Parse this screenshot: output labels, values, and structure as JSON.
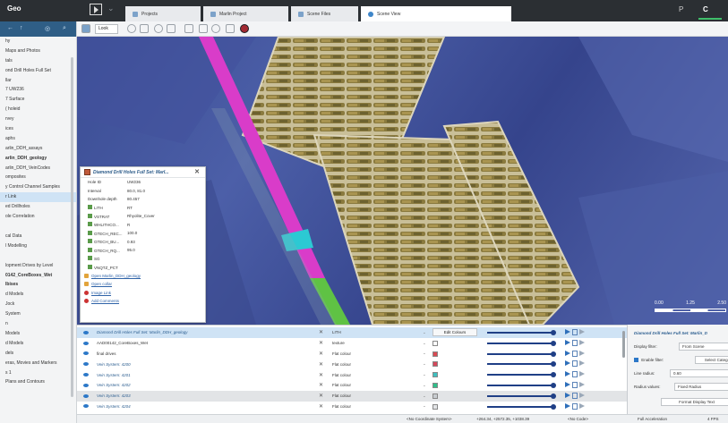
{
  "topbar": {
    "app_name": "Geo",
    "tabs": [
      {
        "label": "Projects"
      },
      {
        "label": "Marlin Project"
      },
      {
        "label": "Scene Files"
      },
      {
        "label": "Scene View"
      }
    ],
    "right_icons": [
      "P",
      "C"
    ]
  },
  "sidebar": {
    "items": [
      {
        "label": "hy"
      },
      {
        "label": "Maps and Photos"
      },
      {
        "label": "tals"
      },
      {
        "label": "ond Drill Holes Full Set"
      },
      {
        "label": "llar"
      },
      {
        "label": "7 UW236"
      },
      {
        "label": "7 Surface"
      },
      {
        "label": "( holeid"
      },
      {
        "label": "rvey"
      },
      {
        "label": "ices"
      },
      {
        "label": "aphs"
      },
      {
        "label": "arlin_DDH_assays"
      },
      {
        "label": "arlin_DDH_geology"
      },
      {
        "label": "arlin_DDH_VeinCodes"
      },
      {
        "label": "omposites"
      },
      {
        "label": "y Control Channel Samples"
      },
      {
        "label": "r Link"
      },
      {
        "label": "ed Drillholes"
      },
      {
        "label": "ole Correlation"
      },
      {
        "label": "cal Data"
      },
      {
        "label": "l Modelling"
      },
      {
        "label": "lopment Drives by Level"
      },
      {
        "label": "0142_CoreBoxes_Wet"
      },
      {
        "label": "Ibises"
      },
      {
        "label": "d Models"
      },
      {
        "label": "Jock"
      },
      {
        "label": "System"
      },
      {
        "label": "n"
      },
      {
        "label": "Models"
      },
      {
        "label": "d Models"
      },
      {
        "label": "dels"
      },
      {
        "label": "eras, Movies and Markers"
      },
      {
        "label": "s 1"
      },
      {
        "label": "Plans and Contours"
      }
    ]
  },
  "scene_toolbar": {
    "look_label": "Look"
  },
  "scale_bar": {
    "ticks": [
      "0.00",
      "1.25",
      "2.50"
    ]
  },
  "popup": {
    "title": "Diamond Drill Holes Full Set: Marl...",
    "rows": [
      {
        "key": "Hole ID",
        "value": "UW236"
      },
      {
        "key": "Interval",
        "value": "80.0, 81.0"
      },
      {
        "key": "Downhole depth",
        "value": "80.457"
      },
      {
        "key": "LITH",
        "value": "RT"
      },
      {
        "key": "VSTRAT",
        "value": "Rhyolite_Cover"
      },
      {
        "key": "WHLITHCO...",
        "value": "R"
      },
      {
        "key": "GTECH_REC...",
        "value": "100.0"
      },
      {
        "key": "GTECH_BU...",
        "value": "0.93"
      },
      {
        "key": "GTECH_RQ...",
        "value": "95.0"
      },
      {
        "key": "SG",
        "value": ""
      },
      {
        "key": "VNQTZ_PCT",
        "value": ""
      }
    ],
    "links": [
      {
        "label": "Open Marlin_DDH_geology"
      },
      {
        "label": "Open collar"
      },
      {
        "label": "Image Link"
      },
      {
        "label": "Add Comments"
      }
    ]
  },
  "layers": [
    {
      "name": "Diamond Drill Holes Full Set: Marlin_DDH_geology",
      "prop": "LITH",
      "action": "Edit Colours"
    },
    {
      "name": "AAD00142_CoreBoxes_Wet",
      "prop": "texture",
      "action": ""
    },
    {
      "name": "final drives",
      "prop": "Flat colour",
      "action": ""
    },
    {
      "name": "Vein System: 4200",
      "prop": "Flat colour",
      "action": ""
    },
    {
      "name": "Vein System: 4201",
      "prop": "Flat colour",
      "action": ""
    },
    {
      "name": "Vein System: 4202",
      "prop": "Flat colour",
      "action": ""
    },
    {
      "name": "Vein System: 4203",
      "prop": "Flat colour",
      "action": ""
    },
    {
      "name": "Vein System: 4204",
      "prop": "Flat colour",
      "action": ""
    }
  ],
  "props_panel": {
    "title": "Diamond Drill Holes Full Set: Marlin_D",
    "display_filter_label": "Display filter:",
    "display_filter_value": "From Scene",
    "enable_filter_label": "Enable filter:",
    "select_category_label": "Select Catego",
    "line_radius_label": "Line radius:",
    "line_radius_value": "0.60",
    "radius_values_label": "Radius values:",
    "radius_values_value": "Fixed Radius",
    "format_text_label": "Format Display Text"
  },
  "statusbar": {
    "coord_system": "<No Coordinate System>",
    "coordinates": "+264.34, +2572.35, +1038.39",
    "code": "<No Code>",
    "acceleration": "Full Acceleration",
    "fps": "4 FPS"
  },
  "colors": {
    "drill_magenta": "#d93cc9",
    "drill_green": "#5fc244",
    "drill_cyan": "#2cc9d3",
    "scene_blue": "#3b4d94",
    "accent": "#2c78c8"
  }
}
